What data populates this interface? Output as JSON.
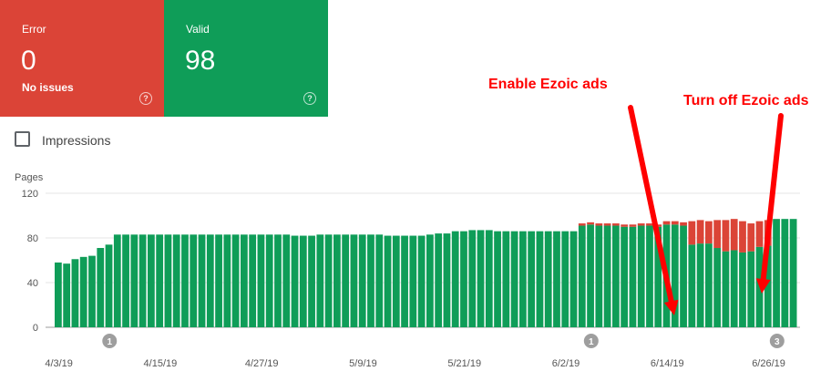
{
  "cards": {
    "error": {
      "label": "Error",
      "value": "0",
      "sub": "No issues",
      "help_icon": "question-circle-icon",
      "color": "#db4437"
    },
    "valid": {
      "label": "Valid",
      "value": "98",
      "help_icon": "question-circle-icon",
      "color": "#0f9d58"
    }
  },
  "toggle": {
    "label": "Impressions",
    "checked": false
  },
  "annotations": {
    "enable": "Enable Ezoic ads",
    "disable": "Turn off Ezoic ads",
    "color": "#ff0000"
  },
  "chart_data": {
    "type": "bar",
    "stacked": true,
    "ylabel": "Pages",
    "ylim": [
      0,
      120
    ],
    "yticks": [
      0,
      40,
      80,
      120
    ],
    "grid": true,
    "x_tick_labels": [
      {
        "label": "4/3/19",
        "index": 0
      },
      {
        "label": "4/15/19",
        "index": 12
      },
      {
        "label": "4/27/19",
        "index": 24
      },
      {
        "label": "5/9/19",
        "index": 36
      },
      {
        "label": "5/21/19",
        "index": 48
      },
      {
        "label": "6/2/19",
        "index": 60
      },
      {
        "label": "6/14/19",
        "index": 72
      },
      {
        "label": "6/26/19",
        "index": 84
      }
    ],
    "markers": [
      {
        "label": "1",
        "index": 6
      },
      {
        "label": "1",
        "index": 63
      },
      {
        "label": "3",
        "index": 85
      }
    ],
    "series": [
      {
        "name": "Valid",
        "color": "#0f9d58",
        "values": [
          58,
          57,
          61,
          63,
          64,
          71,
          74,
          83,
          83,
          83,
          83,
          83,
          83,
          83,
          83,
          83,
          83,
          83,
          83,
          83,
          83,
          83,
          83,
          83,
          83,
          83,
          83,
          83,
          82,
          82,
          82,
          83,
          83,
          83,
          83,
          83,
          83,
          83,
          83,
          82,
          82,
          82,
          82,
          82,
          83,
          84,
          84,
          86,
          86,
          87,
          87,
          87,
          86,
          86,
          86,
          86,
          86,
          86,
          86,
          86,
          86,
          86,
          91,
          92,
          91,
          91,
          91,
          90,
          90,
          91,
          91,
          90,
          92,
          92,
          91,
          74,
          75,
          75,
          71,
          68,
          69,
          67,
          68,
          72,
          73,
          97,
          97,
          97
        ]
      },
      {
        "name": "Error",
        "color": "#db4437",
        "values": [
          0,
          0,
          0,
          0,
          0,
          0,
          0,
          0,
          0,
          0,
          0,
          0,
          0,
          0,
          0,
          0,
          0,
          0,
          0,
          0,
          0,
          0,
          0,
          0,
          0,
          0,
          0,
          0,
          0,
          0,
          0,
          0,
          0,
          0,
          0,
          0,
          0,
          0,
          0,
          0,
          0,
          0,
          0,
          0,
          0,
          0,
          0,
          0,
          0,
          0,
          0,
          0,
          0,
          0,
          0,
          0,
          0,
          0,
          0,
          0,
          0,
          0,
          2,
          2,
          2,
          2,
          2,
          2,
          2,
          2,
          2,
          2,
          3,
          3,
          3,
          21,
          21,
          20,
          25,
          28,
          28,
          28,
          25,
          23,
          23,
          0,
          0,
          0
        ]
      }
    ]
  }
}
